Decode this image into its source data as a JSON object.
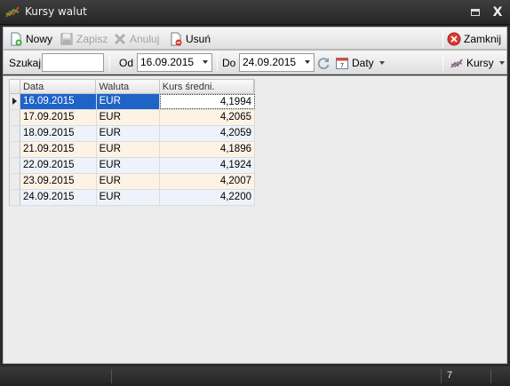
{
  "window": {
    "title": "Kursy walut",
    "minimize_glyph": "",
    "close_glyph": "X"
  },
  "toolbar": {
    "new_label": "Nowy",
    "save_label": "Zapisz",
    "cancel_label": "Anuluj",
    "delete_label": "Usuń",
    "close_label": "Zamknij"
  },
  "filter": {
    "search_label": "Szukaj",
    "search_value": "",
    "from_label": "Od",
    "from_value": "16.09.2015",
    "to_label": "Do",
    "to_value": "24.09.2015",
    "dates_label": "Daty",
    "rates_label": "Kursy"
  },
  "grid": {
    "headers": [
      "Data",
      "Waluta",
      "Kurs średni."
    ],
    "rows": [
      {
        "date": "16.09.2015",
        "currency": "EUR",
        "rate": "4,1994"
      },
      {
        "date": "17.09.2015",
        "currency": "EUR",
        "rate": "4,2065"
      },
      {
        "date": "18.09.2015",
        "currency": "EUR",
        "rate": "4,2059"
      },
      {
        "date": "21.09.2015",
        "currency": "EUR",
        "rate": "4,1896"
      },
      {
        "date": "22.09.2015",
        "currency": "EUR",
        "rate": "4,1924"
      },
      {
        "date": "23.09.2015",
        "currency": "EUR",
        "rate": "4,2007"
      },
      {
        "date": "24.09.2015",
        "currency": "EUR",
        "rate": "4,2200"
      }
    ]
  },
  "statusbar": {
    "count": "7"
  },
  "colors": {
    "selection": "#1f63c7",
    "row_odd": "#eef2fb",
    "row_even": "#fdf3e5",
    "titlebar": "#2e2e2e"
  },
  "icons": [
    "app-chart-icon",
    "new-doc-icon",
    "save-icon",
    "cancel-x-icon",
    "delete-icon",
    "close-circle-icon",
    "refresh-icon",
    "calendar-icon",
    "currency-icon"
  ]
}
